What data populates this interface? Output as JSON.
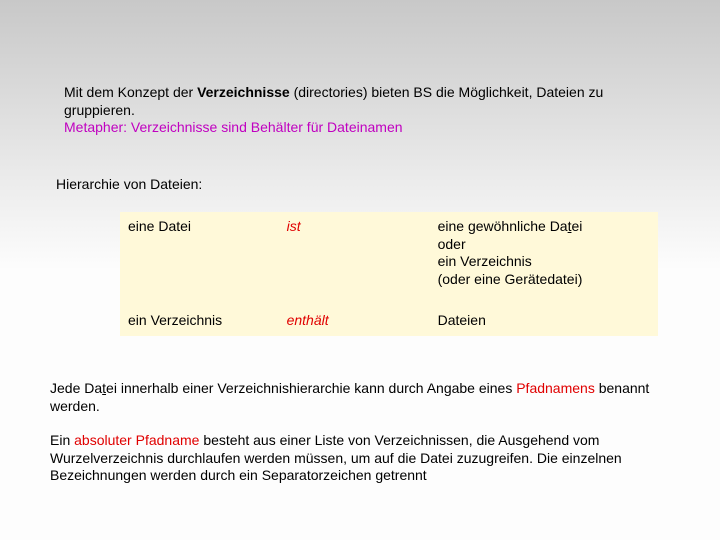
{
  "para1": {
    "t1": "Mit dem Konzept der ",
    "t2": "Verzeichnisse",
    "t3": " (directories) bieten BS die Möglichkeit, Dateien zu gruppieren.",
    "t4": "Metapher: Verzeichnisse sind Behälter für Dateinamen"
  },
  "hierTitle": "Hierarchie von Dateien:",
  "table": {
    "r1c1": "eine Datei",
    "r1c2": "ist",
    "r1c3a": "eine gewöhnliche Da",
    "r1c3a_tail": "t",
    "r1c3a_end": "ei",
    "r1c3b": "oder",
    "r1c3c": "ein Verzeichnis",
    "r1c3d": "(oder eine Gerätedatei)",
    "r2c1": "ein Verzeichnis",
    "r2c2": "enthält",
    "r2c3": "Dateien"
  },
  "para3": {
    "t1": "Jede ",
    "t2": "Da",
    "t2b": "t",
    "t2c": "ei",
    "t3": " innerhalb einer Verzeichnishierarchie kann durch Angabe eines ",
    "t4": "Pfadnamens",
    "t5": " benannt werden."
  },
  "para4": {
    "t1": "Ein ",
    "t2": "absoluter Pfadname",
    "t3": " besteht aus einer Liste von Verzeichnissen, die Ausgehend vom Wurzelverzeichnis durchlaufen werden müssen, um auf die Datei zuzugreifen. Die einzelnen Bezeichnungen werden durch ein Separatorzeichen getrennt"
  }
}
